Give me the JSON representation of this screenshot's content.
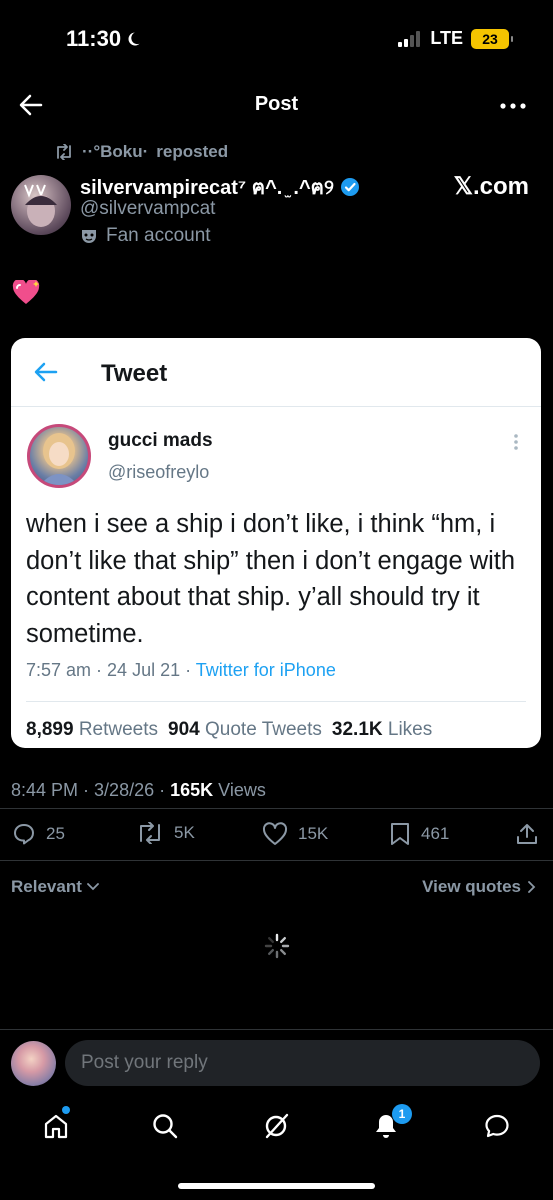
{
  "status_bar": {
    "time": "11:30",
    "network": "LTE",
    "battery": "23"
  },
  "nav": {
    "title": "Post"
  },
  "repost": {
    "user": "··°Boku·",
    "suffix": "reposted"
  },
  "author": {
    "display_name": "silvervampirecat⁷ ฅ^. ̫ .^ฅ୨",
    "handle": "@silvervampcat",
    "label": "Fan account"
  },
  "watermark": "𝕏.com",
  "post_text_emoji": "💖",
  "embedded_tweet": {
    "header": "Tweet",
    "name": "gucci mads",
    "handle": "@riseofreylo",
    "text": "when i see a ship i don’t like, i think “hm, i don’t like that ship” then i don’t engage with content about that ship. y’all should try it sometime.",
    "time": "7:57 am",
    "date": "24 Jul 21",
    "client": "Twitter for iPhone",
    "retweets_count": "8,899",
    "retweets_label": "Retweets",
    "quotes_count": "904",
    "quotes_label": "Quote Tweets",
    "likes_count": "32.1K",
    "likes_label": "Likes"
  },
  "post_meta": {
    "time": "8:44 PM",
    "date": "3/28/26",
    "views_count": "165K",
    "views_label": "Views"
  },
  "actions": {
    "replies": "25",
    "reposts": "5K",
    "likes": "15K",
    "bookmarks": "461"
  },
  "replies_filter": {
    "label": "Relevant",
    "view_quotes": "View quotes"
  },
  "reply_bar": {
    "placeholder": "Post your reply"
  },
  "bottom_nav": {
    "notifications_badge": "1"
  },
  "colors": {
    "accent": "#1d9bf0",
    "verified": "#1d9bf0",
    "battery": "#f5c400",
    "avatar_ring": "#c6497a"
  },
  "icons": [
    "back-arrow-icon",
    "more-icon",
    "repost-icon",
    "verified-badge-icon",
    "mask-icon",
    "reply-icon",
    "like-icon",
    "bookmark-icon",
    "share-icon",
    "chevron-down-icon",
    "chevron-right-icon",
    "loading-spinner-icon",
    "home-icon",
    "search-icon",
    "grok-icon",
    "bell-icon",
    "messages-icon"
  ]
}
